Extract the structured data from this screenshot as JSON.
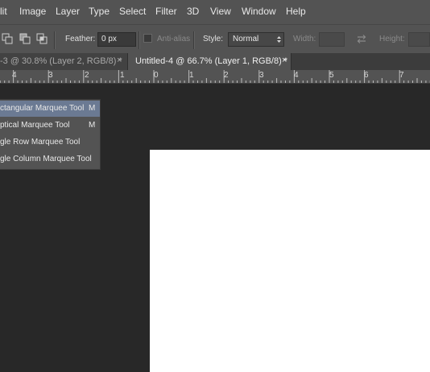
{
  "menubar": {
    "items": [
      "lit",
      "Image",
      "Layer",
      "Type",
      "Select",
      "Filter",
      "3D",
      "View",
      "Window",
      "Help"
    ]
  },
  "options": {
    "feather_label": "Feather:",
    "feather_value": "0 px",
    "antialias_label": "Anti-alias",
    "style_label": "Style:",
    "style_value": "Normal",
    "width_label": "Width:",
    "height_label": "Height:"
  },
  "tabs": [
    {
      "label": "-3 @ 30.8% (Layer 2, RGB/8) *",
      "close": "×",
      "active": false
    },
    {
      "label": "Untitled-4 @ 66.7% (Layer 1, RGB/8) *",
      "close": "×",
      "active": true
    }
  ],
  "ruler": {
    "labels": [
      "4",
      "3",
      "2",
      "1",
      "0",
      "1",
      "2",
      "3",
      "4",
      "5",
      "6",
      "7"
    ]
  },
  "flyout": {
    "items": [
      {
        "label": "ctangular Marquee Tool",
        "shortcut": "M",
        "selected": true
      },
      {
        "label": "ptical Marquee Tool",
        "shortcut": "M",
        "selected": false
      },
      {
        "label": "gle Row Marquee Tool",
        "shortcut": "",
        "selected": false
      },
      {
        "label": "gle Column Marquee Tool",
        "shortcut": "",
        "selected": false
      }
    ]
  },
  "colors": {
    "panel": "#535353",
    "workspace": "#282828",
    "selection": "#6b7a93",
    "canvas": "#ffffff"
  }
}
